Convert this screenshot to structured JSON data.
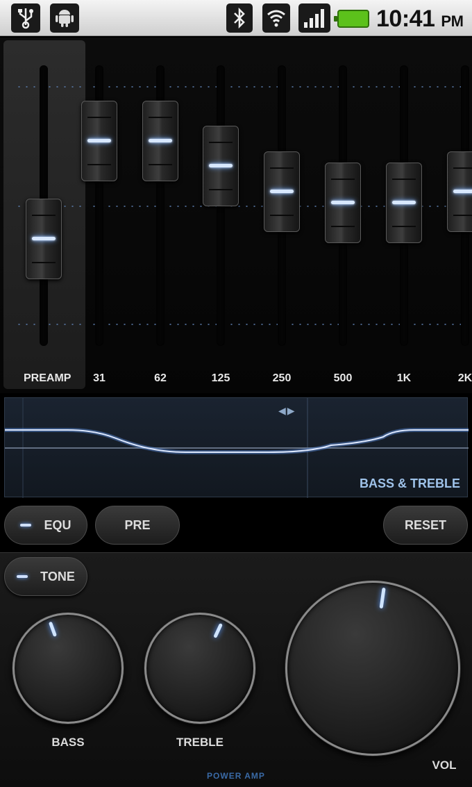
{
  "status_bar": {
    "icons": [
      "usb-icon",
      "android-icon",
      "bluetooth-icon",
      "wifi-icon",
      "signal-icon",
      "battery-icon"
    ],
    "time": "10:41",
    "ampm": "PM"
  },
  "equalizer": {
    "preamp_label": "PREAMP",
    "preamp_level": 0.62,
    "bands": [
      {
        "label": "31",
        "level": 0.27
      },
      {
        "label": "62",
        "level": 0.27
      },
      {
        "label": "125",
        "level": 0.36
      },
      {
        "label": "250",
        "level": 0.45
      },
      {
        "label": "500",
        "level": 0.49
      },
      {
        "label": "1K",
        "level": 0.49
      },
      {
        "label": "2K",
        "level": 0.45
      }
    ]
  },
  "curve_panel": {
    "label": "BASS & TREBLE",
    "arrows": "◀▶"
  },
  "buttons": {
    "equ": "EQU",
    "pre": "PRE",
    "reset": "RESET",
    "tone": "TONE"
  },
  "knobs": {
    "bass": {
      "label": "BASS",
      "angle": -20
    },
    "treble": {
      "label": "TREBLE",
      "angle": 25
    },
    "vol": {
      "label": "VOL",
      "angle": 8
    }
  },
  "brand": "POWER AMP",
  "colors": {
    "accent_glow": "#6aa6ff",
    "label_blue": "#9fc3ea",
    "battery": "#5cc11b"
  }
}
